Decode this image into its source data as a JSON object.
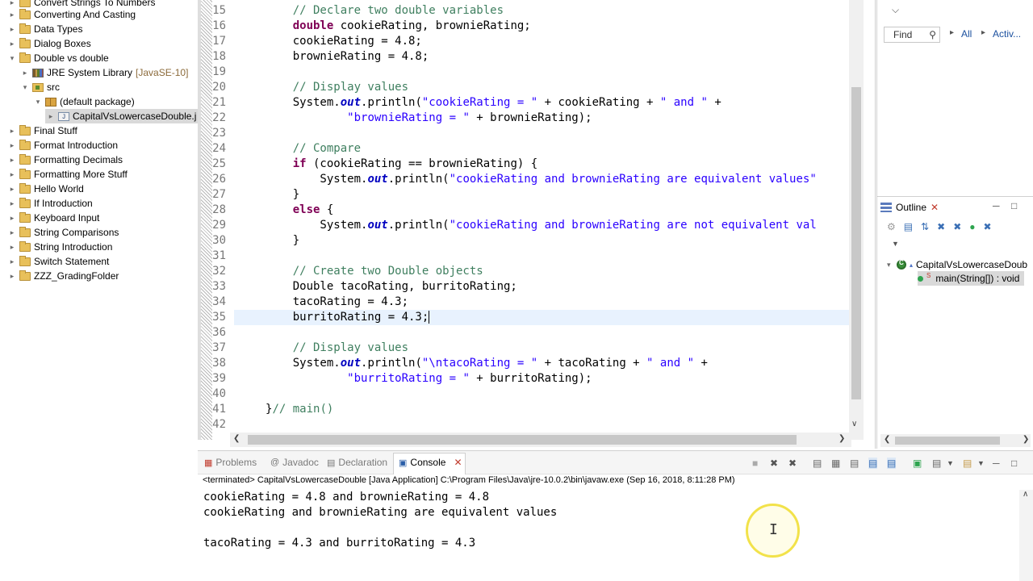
{
  "explorer": {
    "items": [
      {
        "label": "Convert Strings To Numbers"
      },
      {
        "label": "Converting And Casting"
      },
      {
        "label": "Data Types"
      },
      {
        "label": "Dialog Boxes"
      },
      {
        "label": "Double vs double"
      },
      {
        "label": "JRE System Library",
        "suffix": "[JavaSE-10]"
      },
      {
        "label": "src"
      },
      {
        "label": "(default package)"
      },
      {
        "label": "CapitalVsLowercaseDouble.j"
      },
      {
        "label": "Final Stuff"
      },
      {
        "label": "Format Introduction"
      },
      {
        "label": "Formatting Decimals"
      },
      {
        "label": "Formatting More Stuff"
      },
      {
        "label": "Hello World"
      },
      {
        "label": "If Introduction"
      },
      {
        "label": "Keyboard Input"
      },
      {
        "label": "String Comparisons"
      },
      {
        "label": "String Introduction"
      },
      {
        "label": "Switch Statement"
      },
      {
        "label": "ZZZ_GradingFolder"
      }
    ]
  },
  "editor": {
    "lines": [
      {
        "n": "15",
        "text": "    // Declare two double variables"
      },
      {
        "n": "16",
        "text": "    double cookieRating, brownieRating;"
      },
      {
        "n": "17",
        "text": "    cookieRating = 4.8;"
      },
      {
        "n": "18",
        "text": "    brownieRating = 4.8;"
      },
      {
        "n": "19",
        "text": ""
      },
      {
        "n": "20",
        "text": "    // Display values"
      },
      {
        "n": "21",
        "text": "    System.out.println(\"cookieRating = \" + cookieRating + \" and \" +"
      },
      {
        "n": "22",
        "text": "            \"brownieRating = \" + brownieRating);"
      },
      {
        "n": "23",
        "text": ""
      },
      {
        "n": "24",
        "text": "    // Compare"
      },
      {
        "n": "25",
        "text": "    if (cookieRating == brownieRating) {"
      },
      {
        "n": "26",
        "text": "        System.out.println(\"cookieRating and brownieRating are equivalent values\""
      },
      {
        "n": "27",
        "text": "    }"
      },
      {
        "n": "28",
        "text": "    else {"
      },
      {
        "n": "29",
        "text": "        System.out.println(\"cookieRating and brownieRating are not equivalent val"
      },
      {
        "n": "30",
        "text": "    }"
      },
      {
        "n": "31",
        "text": ""
      },
      {
        "n": "32",
        "text": "    // Create two Double objects"
      },
      {
        "n": "33",
        "text": "    Double tacoRating, burritoRating;"
      },
      {
        "n": "34",
        "text": "    tacoRating = 4.3;"
      },
      {
        "n": "35",
        "text": "    burritoRating = 4.3;"
      },
      {
        "n": "36",
        "text": ""
      },
      {
        "n": "37",
        "text": "    // Display values"
      },
      {
        "n": "38",
        "text": "    System.out.println(\"\\ntacoRating = \" + tacoRating + \" and \" +"
      },
      {
        "n": "39",
        "text": "            \"burritoRating = \" + burritoRating);"
      },
      {
        "n": "40",
        "text": ""
      },
      {
        "n": "41",
        "text": "}// main()"
      },
      {
        "n": "42",
        "text": ""
      }
    ],
    "current_line": "35"
  },
  "task_panel": {
    "find_placeholder": "Find",
    "all_label": "All",
    "activate_label": "Activ..."
  },
  "outline": {
    "title": "Outline",
    "class_label": "CapitalVsLowercaseDoub",
    "method_label": "main(String[]) : void"
  },
  "console": {
    "tabs": [
      {
        "label": "Problems"
      },
      {
        "label": "Javadoc"
      },
      {
        "label": "Declaration"
      },
      {
        "label": "Console"
      }
    ],
    "status": "<terminated> CapitalVsLowercaseDouble [Java Application] C:\\Program Files\\Java\\jre-10.0.2\\bin\\javaw.exe (Sep 16, 2018, 8:11:28 PM)",
    "output": [
      "cookieRating = 4.8 and brownieRating = 4.8",
      "cookieRating and brownieRating are equivalent values",
      "",
      "tacoRating = 4.3 and burritoRating = 4.3"
    ]
  },
  "colors": {
    "keyword": "#7f0055",
    "comment": "#3f7f5f",
    "string": "#2a00ff",
    "field": "#0000c0",
    "current_line_bg": "#e8f2fe",
    "cursor_ring": "#f2e24a"
  }
}
